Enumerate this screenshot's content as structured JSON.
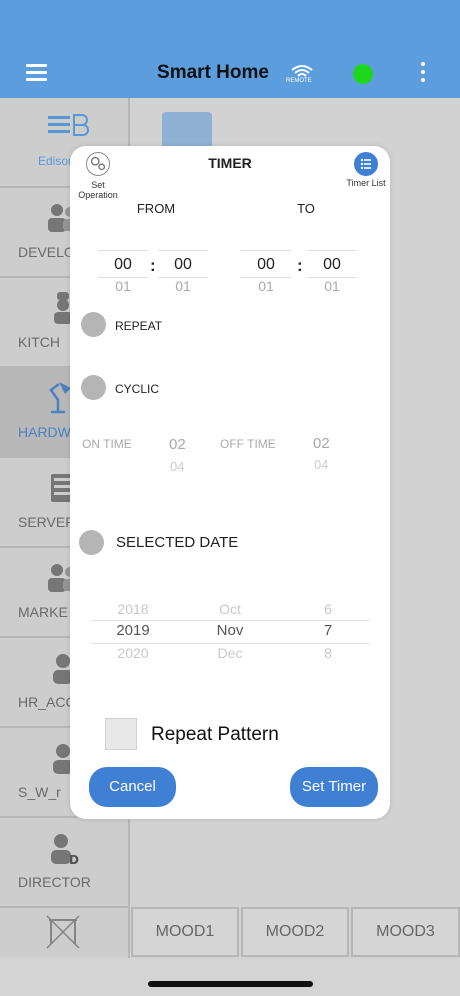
{
  "header": {
    "title": "Smart Home",
    "remote_label": "REMOTE",
    "status_color": "#1ed61e",
    "accent": "#5b9ddd"
  },
  "sidebar": {
    "items": [
      {
        "label": "EdisonB",
        "icon": "logo-icon"
      },
      {
        "label": "DEVELO",
        "icon": "group-icon"
      },
      {
        "label": "KITCH",
        "icon": "chef-icon"
      },
      {
        "label": "HARDW",
        "icon": "lamp-icon",
        "active": true
      },
      {
        "label": "SERVER",
        "icon": "server-icon"
      },
      {
        "label": "MARKE",
        "icon": "group-icon"
      },
      {
        "label": "HR_ACCO",
        "icon": "person-icon"
      },
      {
        "label": "S_W_r",
        "icon": "person-icon"
      },
      {
        "label": "DIRECTOR",
        "icon": "director-icon"
      }
    ]
  },
  "moods": [
    "MOOD1",
    "MOOD2",
    "MOOD3"
  ],
  "timer_modal": {
    "title": "TIMER",
    "set_operation_label": "Set Operation",
    "timer_list_label": "Timer List",
    "from_label": "FROM",
    "to_label": "TO",
    "from_hour": "00",
    "from_min": "00",
    "from_hour_next": "01",
    "from_min_next": "01",
    "to_hour": "00",
    "to_min": "00",
    "to_hour_next": "01",
    "to_min_next": "01",
    "colon": ":",
    "repeat_label": "REPEAT",
    "cyclic_label": "CYCLIC",
    "on_time_label": "ON TIME",
    "off_time_label": "OFF TIME",
    "on_time_value": "02",
    "on_time_next": "04",
    "off_time_value": "02",
    "off_time_next": "04",
    "selected_date_label": "SELECTED DATE",
    "years": [
      "2018",
      "2019",
      "2020"
    ],
    "months": [
      "Oct",
      "Nov",
      "Dec"
    ],
    "days": [
      "6",
      "7",
      "8"
    ],
    "repeat_pattern_label": "Repeat Pattern",
    "cancel_label": "Cancel",
    "set_timer_label": "Set Timer"
  }
}
